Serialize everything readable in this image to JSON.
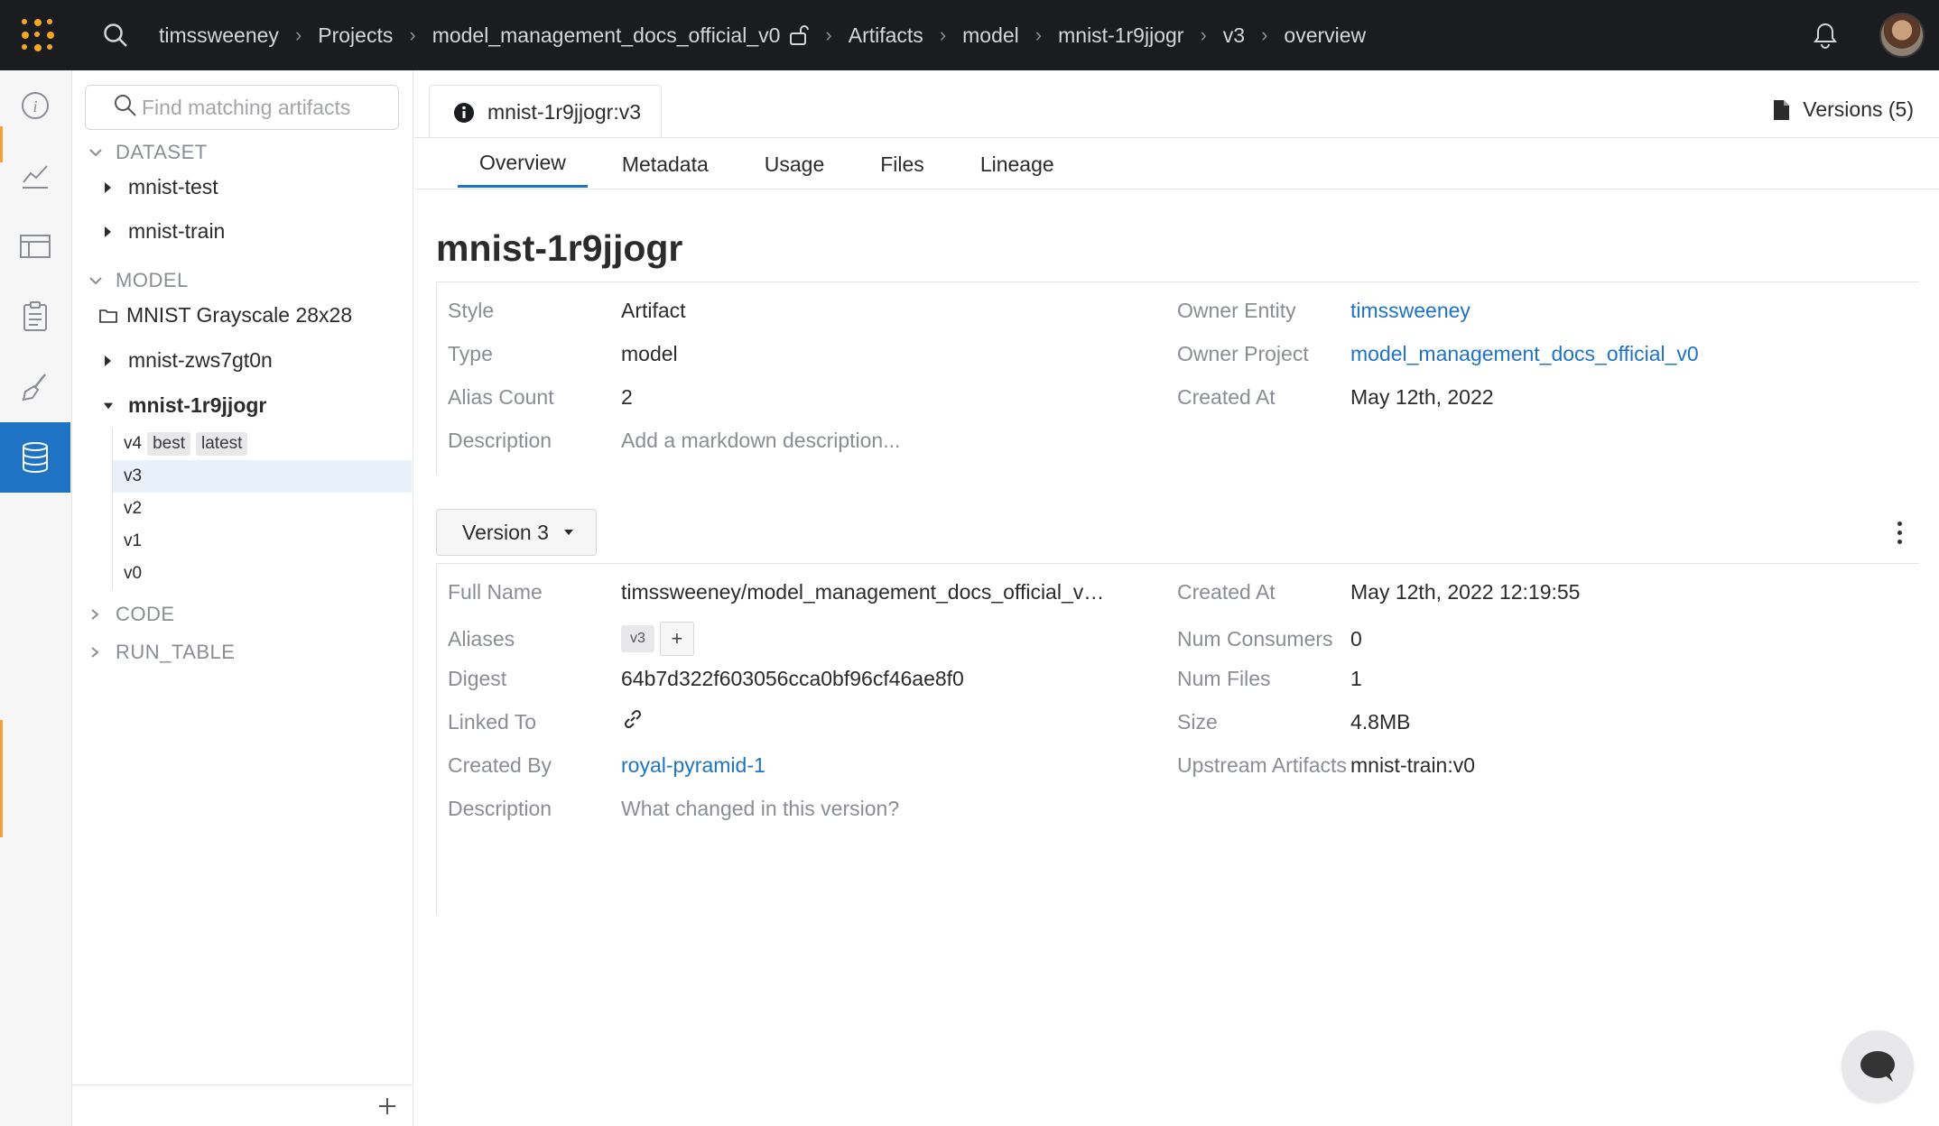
{
  "topbar": {
    "breadcrumbs": [
      "timssweeney",
      "Projects",
      "model_management_docs_official_v0",
      "Artifacts",
      "model",
      "mnist-1r9jjogr",
      "v3",
      "overview"
    ],
    "icons": [
      "wandb-logo-icon",
      "search-icon",
      "lock-open-icon",
      "bell-icon",
      "avatar"
    ]
  },
  "rail": {
    "items": [
      "info-icon",
      "chart-icon",
      "table-icon",
      "report-icon",
      "sweep-icon",
      "database-icon"
    ],
    "active": "database-icon"
  },
  "sidebar": {
    "search_placeholder": "Find matching artifacts",
    "groups": {
      "dataset": "DATASET",
      "model": "MODEL",
      "code": "CODE",
      "run_table": "RUN_TABLE"
    },
    "dataset_items": [
      "mnist-test",
      "mnist-train"
    ],
    "model_folder": "MNIST Grayscale 28x28",
    "model_items": [
      "mnist-zws7gt0n",
      "mnist-1r9jjogr"
    ],
    "versions": [
      {
        "label": "v4",
        "tags": [
          "best",
          "latest"
        ]
      },
      {
        "label": "v3",
        "tags": []
      },
      {
        "label": "v2",
        "tags": []
      },
      {
        "label": "v1",
        "tags": []
      },
      {
        "label": "v0",
        "tags": []
      }
    ],
    "selected_version": "v3"
  },
  "main": {
    "tab_title": "mnist-1r9jjogr:v3",
    "versions_button": "Versions (5)",
    "subtabs": [
      "Overview",
      "Metadata",
      "Usage",
      "Files",
      "Lineage"
    ],
    "active_subtab": "Overview",
    "title": "mnist-1r9jjogr",
    "artifact_info": {
      "style_label": "Style",
      "style_value": "Artifact",
      "type_label": "Type",
      "type_value": "model",
      "alias_count_label": "Alias Count",
      "alias_count_value": "2",
      "description_label": "Description",
      "description_placeholder": "Add a markdown description...",
      "owner_entity_label": "Owner Entity",
      "owner_entity_value": "timssweeney",
      "owner_project_label": "Owner Project",
      "owner_project_value": "model_management_docs_official_v0",
      "created_at_label": "Created At",
      "created_at_value": "May 12th, 2022"
    },
    "version_select": "Version 3",
    "version_info": {
      "full_name_label": "Full Name",
      "full_name_value": "timssweeney/model_management_docs_official_v…",
      "aliases_label": "Aliases",
      "alias_chip": "v3",
      "alias_add": "+",
      "digest_label": "Digest",
      "digest_value": "64b7d322f603056cca0bf96cf46ae8f0",
      "linked_to_label": "Linked To",
      "created_by_label": "Created By",
      "created_by_value": "royal-pyramid-1",
      "description_label": "Description",
      "description_placeholder": "What changed in this version?",
      "created_at_label": "Created At",
      "created_at_value": "May 12th, 2022 12:19:55",
      "num_consumers_label": "Num Consumers",
      "num_consumers_value": "0",
      "num_files_label": "Num Files",
      "num_files_value": "1",
      "size_label": "Size",
      "size_value": "4.8MB",
      "upstream_label": "Upstream Artifacts",
      "upstream_value": "mnist-train:v0"
    }
  },
  "colors": {
    "topbar_bg": "#1b1c1f",
    "accent": "#1e73c4",
    "logo": "#f5a623",
    "selected_row": "#e8f1fa"
  }
}
